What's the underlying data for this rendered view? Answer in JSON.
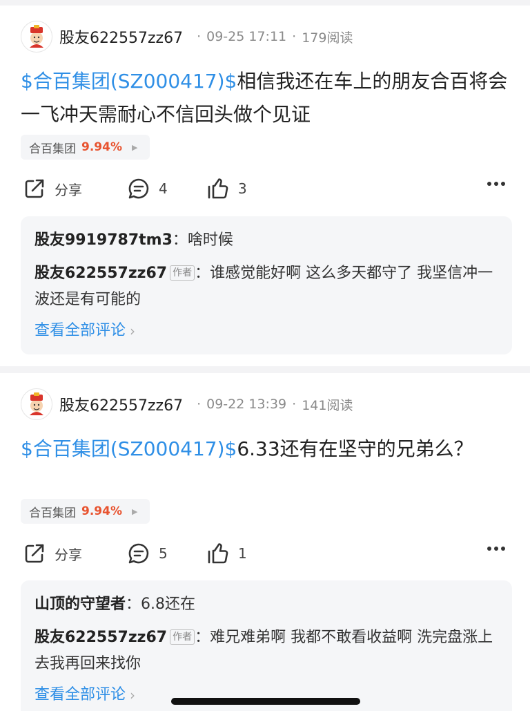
{
  "posts": [
    {
      "username": "股友622557zz67",
      "date": "09-25 17:11",
      "reads": "179阅读",
      "stock_tag": "$合百集团(SZ000417)$",
      "text": "相信我还在车上的朋友合百将会一飞冲天需耐心不信回头做个见证",
      "stock_chip": {
        "name": "合百集团",
        "change": "9.94%"
      },
      "actions": {
        "share_label": "分享",
        "comments": "4",
        "likes": "3"
      },
      "comments": [
        {
          "name": "股友9919787tm3",
          "is_author": false,
          "text": "啥时候"
        },
        {
          "name": "股友622557zz67",
          "is_author": true,
          "text": "谁感觉能好啊 这么多天都守了 我坚信冲一波还是有可能的"
        }
      ],
      "view_all": "查看全部评论"
    },
    {
      "username": "股友622557zz67",
      "date": "09-22 13:39",
      "reads": "141阅读",
      "stock_tag": "$合百集团(SZ000417)$",
      "text": "6.33还有在坚守的兄弟么？",
      "stock_chip": {
        "name": "合百集团",
        "change": "9.94%"
      },
      "actions": {
        "share_label": "分享",
        "comments": "5",
        "likes": "1"
      },
      "comments": [
        {
          "name": "山顶的守望者",
          "is_author": false,
          "text": "6.8还在"
        },
        {
          "name": "股友622557zz67",
          "is_author": true,
          "text": "难兄难弟啊 我都不敢看收益啊 洗完盘涨上去我再回来找你"
        }
      ],
      "view_all": "查看全部评论"
    }
  ],
  "author_label": "作者",
  "separator": "·",
  "colon": "：",
  "colors": {
    "link": "#2f8fe6",
    "up": "#e8532f",
    "panel": "#f5f6f8"
  },
  "icons": {
    "avatar": "caishen-avatar-icon",
    "share": "share-icon",
    "comment": "comment-icon",
    "like": "thumbs-up-icon",
    "more": "more-dots-icon"
  }
}
